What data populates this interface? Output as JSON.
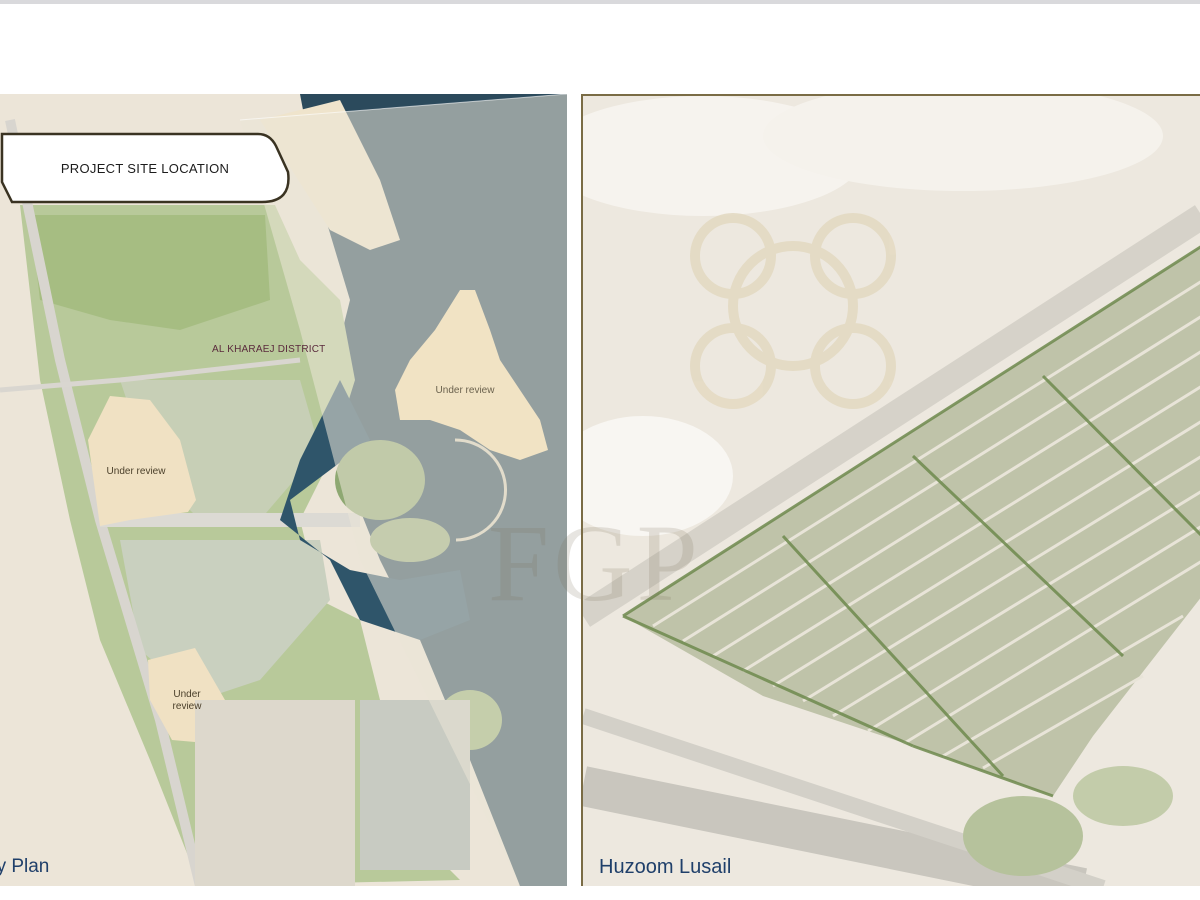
{
  "site_label": "PROJECT SITE LOCATION",
  "district": "AL KHARAEJ DISTRICT",
  "review_labels": [
    "Under review",
    "Under\nreview",
    "Under review"
  ],
  "captions": {
    "left": "ey Plan",
    "right": "Huzoom Lusail"
  },
  "colors": {
    "caption": "#1f3f6a",
    "water": "#24435a",
    "greenery": "#a6c07e",
    "sand": "#f0e1c3",
    "frame": "#7a6c45"
  }
}
